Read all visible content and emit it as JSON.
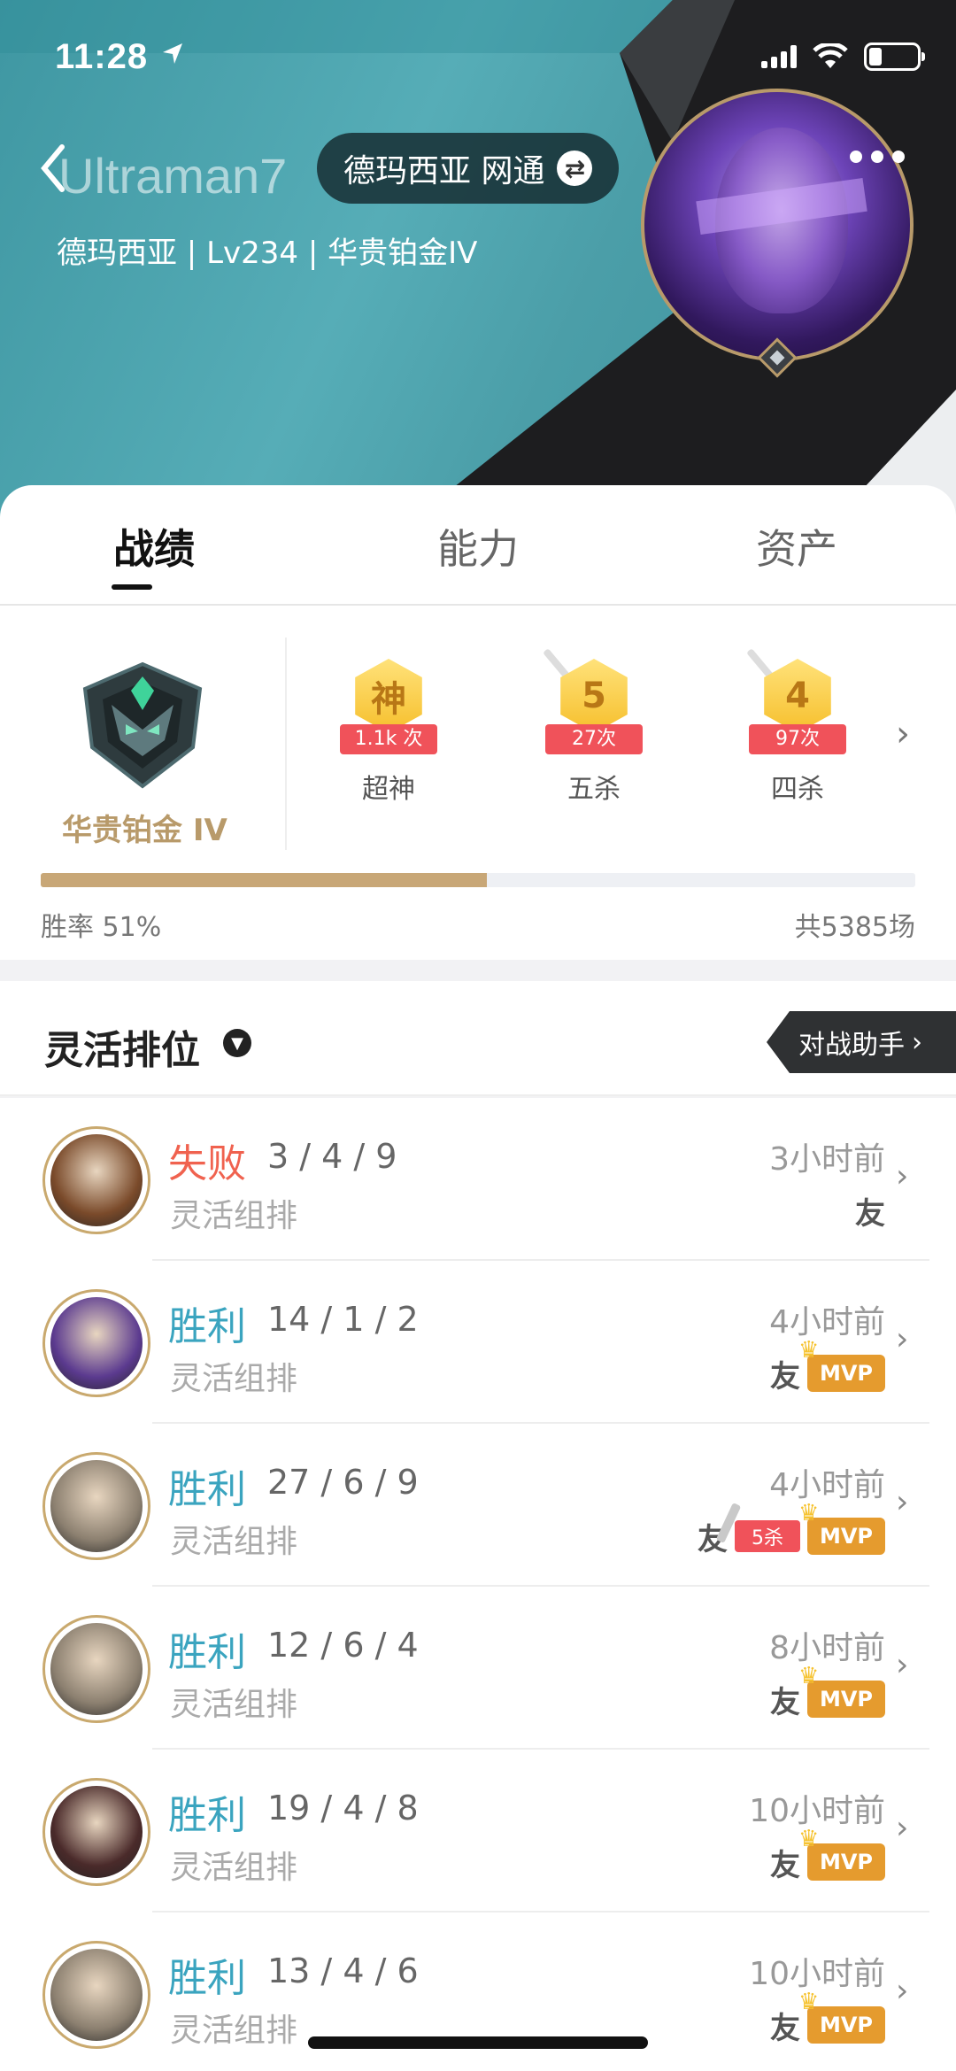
{
  "status": {
    "time": "11:28"
  },
  "profile": {
    "username": "Ultraman7",
    "server_pill": "德玛西亚 网通",
    "subinfo": "德玛西亚 | Lv234 | 华贵铂金IV"
  },
  "tabs": [
    {
      "label": "战绩"
    },
    {
      "label": "能力"
    },
    {
      "label": "资产"
    }
  ],
  "rank": {
    "name": "华贵铂金 IV",
    "win_fraction": 0.51,
    "winrate_text": "胜率 51%",
    "total_text": "共5385场"
  },
  "badges": [
    {
      "glyph": "神",
      "count": "1.1k 次",
      "label": "超神"
    },
    {
      "glyph": "5",
      "count": "27次",
      "label": "五杀"
    },
    {
      "glyph": "4",
      "count": "97次",
      "label": "四杀"
    }
  ],
  "mode_bar": {
    "title": "灵活排位",
    "assist": "对战助手"
  },
  "matches": [
    {
      "result": "失败",
      "outcome": "lose",
      "kda": "3 / 4 / 9",
      "mode": "灵活组排",
      "time": "3小时前",
      "friend": "友",
      "mvp": "",
      "penta": "",
      "hero_color": "#7a4a2a"
    },
    {
      "result": "胜利",
      "outcome": "win",
      "kda": "14 / 1 / 2",
      "mode": "灵活组排",
      "time": "4小时前",
      "friend": "友",
      "mvp": "MVP",
      "penta": "",
      "hero_color": "#5b3a8f"
    },
    {
      "result": "胜利",
      "outcome": "win",
      "kda": "27 / 6 / 9",
      "mode": "灵活组排",
      "time": "4小时前",
      "friend": "友",
      "mvp": "MVP",
      "penta": "5杀",
      "hero_color": "#8c8070"
    },
    {
      "result": "胜利",
      "outcome": "win",
      "kda": "12 / 6 / 4",
      "mode": "灵活组排",
      "time": "8小时前",
      "friend": "友",
      "mvp": "MVP",
      "penta": "",
      "hero_color": "#8c8070"
    },
    {
      "result": "胜利",
      "outcome": "win",
      "kda": "19 / 4 / 8",
      "mode": "灵活组排",
      "time": "10小时前",
      "friend": "友",
      "mvp": "MVP",
      "penta": "",
      "hero_color": "#4a2a2a"
    },
    {
      "result": "胜利",
      "outcome": "win",
      "kda": "13 / 4 / 6",
      "mode": "灵活组排",
      "time": "10小时前",
      "friend": "友",
      "mvp": "MVP",
      "penta": "",
      "hero_color": "#8c8070"
    }
  ],
  "colors": {
    "accent_gold": "#c8a777",
    "win": "#3aa4bf",
    "lose": "#f0624f",
    "mvp": "#e59b2e"
  }
}
